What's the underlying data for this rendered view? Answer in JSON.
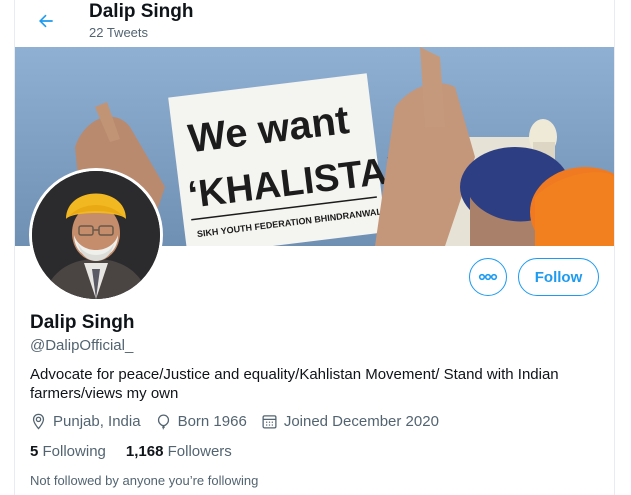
{
  "header": {
    "name": "Dalip Singh",
    "tweet_count": "22 Tweets"
  },
  "banner": {
    "sign_line1": "We want",
    "sign_line2": "‘KHALISTAN’",
    "sign_footer": "SIKH YOUTH FEDERATION BHINDRANWALA"
  },
  "profile": {
    "name": "Dalip Singh",
    "handle": "@DalipOfficial_",
    "bio": "Advocate for peace/Justice and equality/Kahlistan Movement/ Stand with Indian farmers/views my own",
    "location": "Punjab, India",
    "born": "Born 1966",
    "joined": "Joined December 2020"
  },
  "stats": {
    "following_count": "5",
    "following_label": "Following",
    "followers_count": "1,168",
    "followers_label": "Followers"
  },
  "actions": {
    "follow_label": "Follow",
    "more_label": "ooo"
  },
  "notice": "Not followed by anyone you’re following",
  "colors": {
    "accent": "#1d9bf0",
    "text": "#0f1419",
    "muted": "#536471"
  },
  "icons": [
    "arrow-left-icon",
    "more-icon",
    "location-icon",
    "birthday-balloon-icon",
    "calendar-icon"
  ]
}
